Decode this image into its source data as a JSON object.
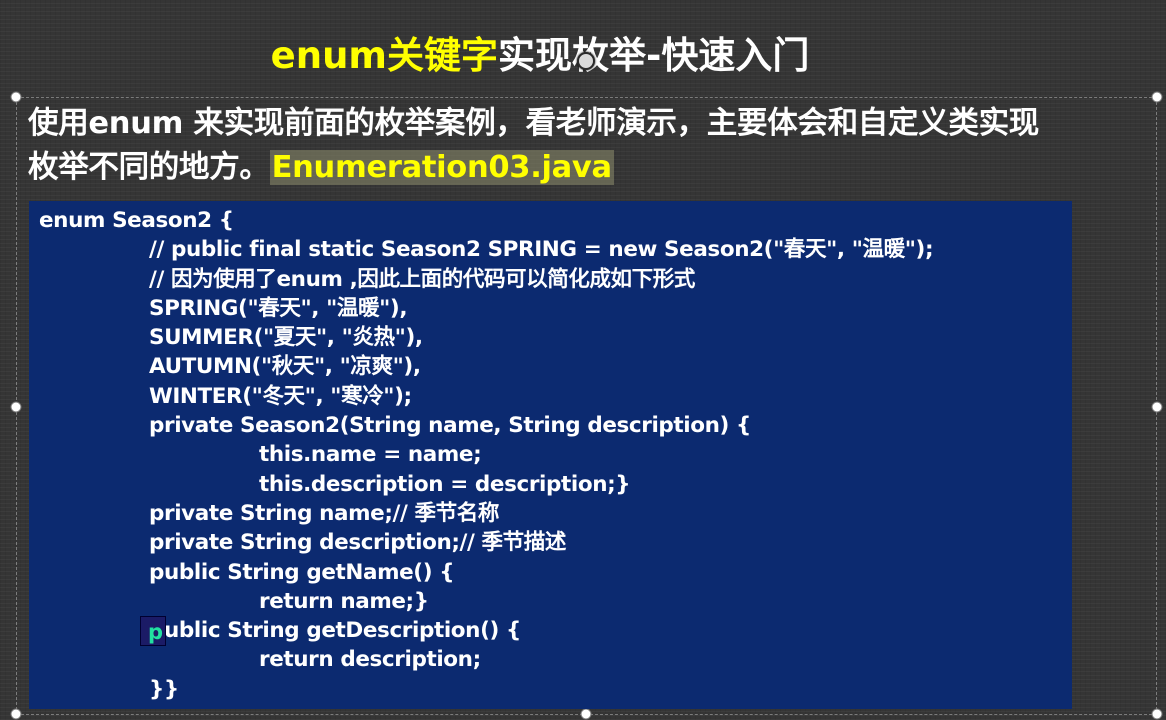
{
  "slide": {
    "title_highlight": "enum关键字",
    "title_rest": "实现枚举-快速入门",
    "intro_line1": "使用enum 来实现前面的枚举案例，看老师演示，主要体会和自定义类实现",
    "intro_line2": "枚举不同的地方。",
    "filename": "Enumeration03.java"
  },
  "code": {
    "lines": [
      {
        "indent": 0,
        "text": "enum Season2 {"
      },
      {
        "indent": 1,
        "text": "// public final static Season2 SPRING = new Season2(\"春天\", \"温暖\");"
      },
      {
        "indent": 1,
        "text": "// 因为使用了enum ,因此上面的代码可以简化成如下形式"
      },
      {
        "indent": 1,
        "text": "SPRING(\"春天\", \"温暖\"),"
      },
      {
        "indent": 1,
        "text": "SUMMER(\"夏天\", \"炎热\"),"
      },
      {
        "indent": 1,
        "text": "AUTUMN(\"秋天\", \"凉爽\"),"
      },
      {
        "indent": 1,
        "text": "WINTER(\"冬天\", \"寒冷\");"
      },
      {
        "indent": 1,
        "text": "private Season2(String name, String description) {"
      },
      {
        "indent": 2,
        "text": "this.name = name;"
      },
      {
        "indent": 2,
        "text": "this.description = description;}"
      },
      {
        "indent": 1,
        "text": "private String name;// 季节名称"
      },
      {
        "indent": 1,
        "text": "private String description;// 季节描述"
      },
      {
        "indent": 1,
        "text": "public String getName() {"
      },
      {
        "indent": 2,
        "text": "return name;}"
      },
      {
        "indent": 1,
        "text": "public String getDescription() {"
      },
      {
        "indent": 2,
        "text": "return description;"
      },
      {
        "indent": 1,
        "text": "}}"
      }
    ]
  },
  "breakpoint": {
    "glyph": "p"
  },
  "colors": {
    "background": "#353535",
    "title_highlight": "#ffff00",
    "code_background": "#0c2a70",
    "code_text": "#ffffff",
    "filename_background": "#808064"
  }
}
